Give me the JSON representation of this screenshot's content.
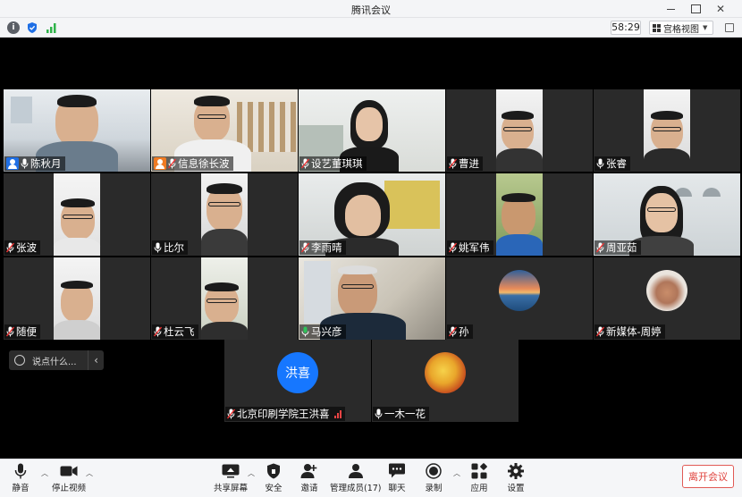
{
  "window": {
    "title": "腾讯会议"
  },
  "infobar": {
    "timer": "58:29",
    "view_label": "宫格视图"
  },
  "participants": [
    {
      "name": "陈秋月"
    },
    {
      "name": "信息徐长波"
    },
    {
      "name": "设艺董琪琪"
    },
    {
      "name": "曹进"
    },
    {
      "name": "张睿"
    },
    {
      "name": "张波"
    },
    {
      "name": "比尔"
    },
    {
      "name": "李雨晴"
    },
    {
      "name": "姚军伟"
    },
    {
      "name": "周亚茹"
    },
    {
      "name": "随便"
    },
    {
      "name": "杜云飞"
    },
    {
      "name": "马兴彦"
    },
    {
      "name": "孙"
    },
    {
      "name": "新媒体-周婷"
    },
    {
      "name": "北京印刷学院王洪喜",
      "avatar_text": "洪喜"
    },
    {
      "name": "一木一花"
    }
  ],
  "chat": {
    "placeholder": "说点什么..."
  },
  "toolbar": {
    "mute": "静音",
    "stop_video": "停止视频",
    "share": "共享屏幕",
    "security": "安全",
    "invite": "邀请",
    "members": "管理成员(17)",
    "chat": "聊天",
    "record": "录制",
    "apps": "应用",
    "settings": "设置",
    "leave": "离开会议"
  },
  "colors": {
    "accent": "#1677ff",
    "speaking": "#2fc35a",
    "leave": "#e0443e"
  }
}
